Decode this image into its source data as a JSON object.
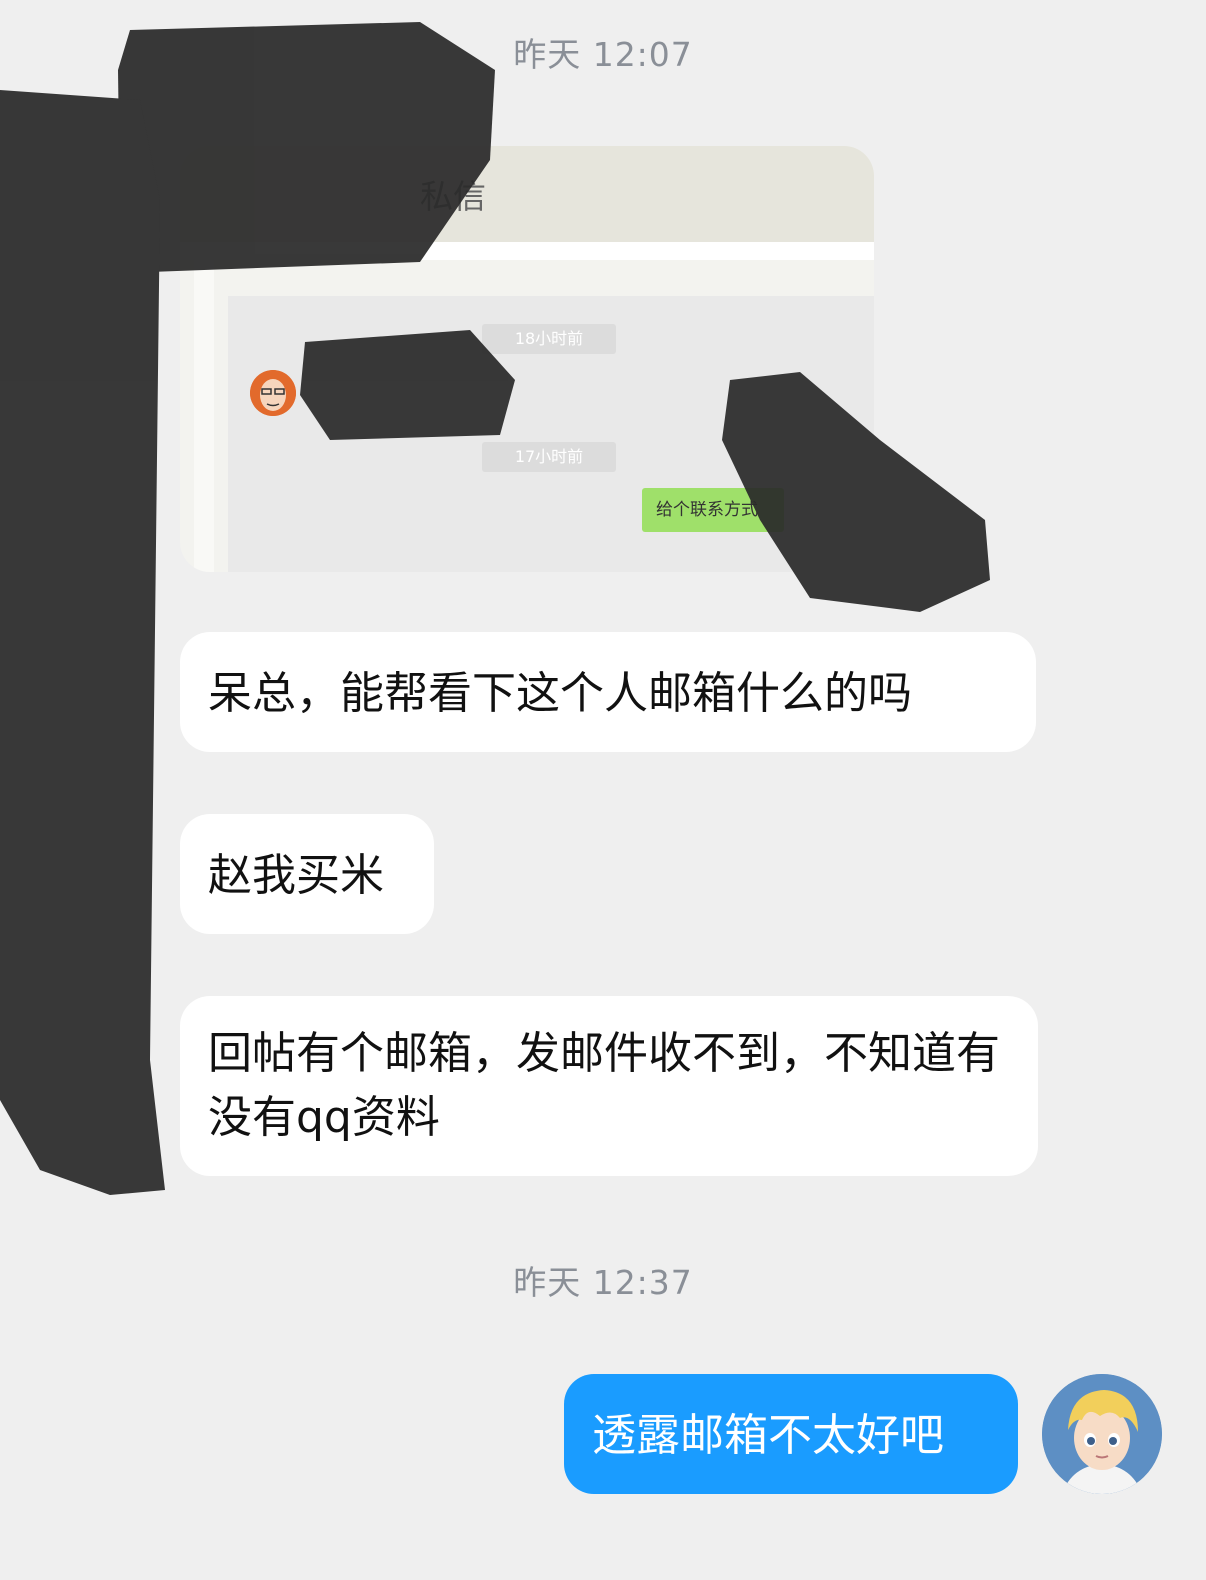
{
  "chat": {
    "timestamps": [
      "昨天 12:07",
      "昨天 12:37"
    ],
    "image_message": {
      "header_title": "私信",
      "times": [
        "18小时前",
        "17小时前"
      ],
      "green_bubble": "给个联系方式"
    },
    "messages_received": [
      "呆总，能帮看下这个人邮箱什么的吗",
      "赵我买米",
      "回帖有个邮箱，发邮件收不到，不知道有没有qq资料"
    ],
    "messages_sent": [
      "透露邮箱不太好吧"
    ]
  },
  "colors": {
    "background": "#efefef",
    "received_bubble": "#ffffff",
    "sent_bubble": "#1a9cff",
    "timestamp_text": "#8a8f97",
    "redaction": "#2a2a2a"
  }
}
